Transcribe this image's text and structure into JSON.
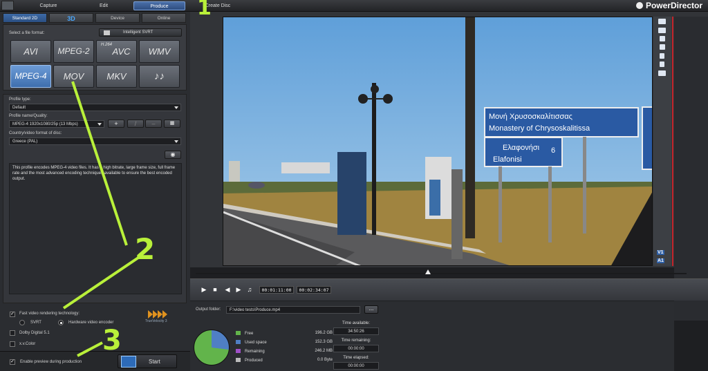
{
  "topbar": {
    "tabs": [
      "Capture",
      "Edit",
      "Produce",
      "Create Disc"
    ],
    "active_tab": "Produce",
    "brand": "PowerDirector"
  },
  "left": {
    "subtabs": [
      "Standard 2D",
      "3D",
      "Device",
      "Online"
    ],
    "select_format_label": "Select a file format:",
    "svrt_button": "Intelligent SVRT",
    "formats": [
      "AVI",
      "MPEG-2",
      "AVC",
      "WMV",
      "MPEG-4",
      "MOV",
      "MKV",
      "♪♪"
    ],
    "avc_prefix": "H.264",
    "selected_format": "MPEG-4",
    "profile_type_label": "Profile type:",
    "profile_type_value": "Default",
    "profile_name_label": "Profile name/Quality:",
    "profile_name_value": "MPEG-4 1920x1080/25p (13 Mbps)",
    "country_label": "Country/video format of disc:",
    "country_value": "Greece (PAL)",
    "description": "This profile encodes MPEG-4 video files. It has a high bitrate, large frame size, full frame rate and the most advanced encoding techniques available to ensure the best encoded output."
  },
  "options": {
    "fast_render": "Fast video rendering technology:",
    "svrt": "SVRT",
    "hw_encoder": "Hardware video encoder",
    "dolby": "Dolby Digital 5.1",
    "xvcolor": "x.v.Color",
    "trueVelocity": "TrueVelocity 3",
    "enable_preview": "Enable preview during production",
    "start": "Start"
  },
  "player": {
    "tracks": [
      "V1",
      "A1"
    ],
    "timecode_current": "00:01:11:00",
    "timecode_total": "00:02:34:07"
  },
  "output": {
    "folder_label": "Output folder:",
    "folder_value": "F:\\video tests\\Produce.mp4",
    "browse": "...",
    "legend": [
      {
        "label": "Free",
        "value": "196.2",
        "unit": "GB",
        "color": "#62b44b"
      },
      {
        "label": "Used space",
        "value": "152.3",
        "unit": "GB",
        "color": "#4f7fc4"
      },
      {
        "label": "Remaining",
        "value": "246.2",
        "unit": "MB",
        "color": "#a050c8"
      },
      {
        "label": "Produced",
        "value": "0.0",
        "unit": "Byte",
        "color": "#bbbbbb"
      }
    ],
    "time_available_label": "Time available:",
    "time_available": "34:50:26",
    "time_remaining_label": "Time remaining:",
    "time_remaining": "00:00:00",
    "time_elapsed_label": "Time elapsed:",
    "time_elapsed": "00:00:00"
  },
  "video": {
    "sign_greek": "Μονή Χρυσοσκαλίτισσας",
    "sign_english": "Monastery of Chrysoskalitissa",
    "sign2_greek": "Ελαφονήσι",
    "sign2_english": "Elafonisi",
    "sign2_km": "6"
  },
  "annotations": [
    "1",
    "2",
    "3"
  ]
}
